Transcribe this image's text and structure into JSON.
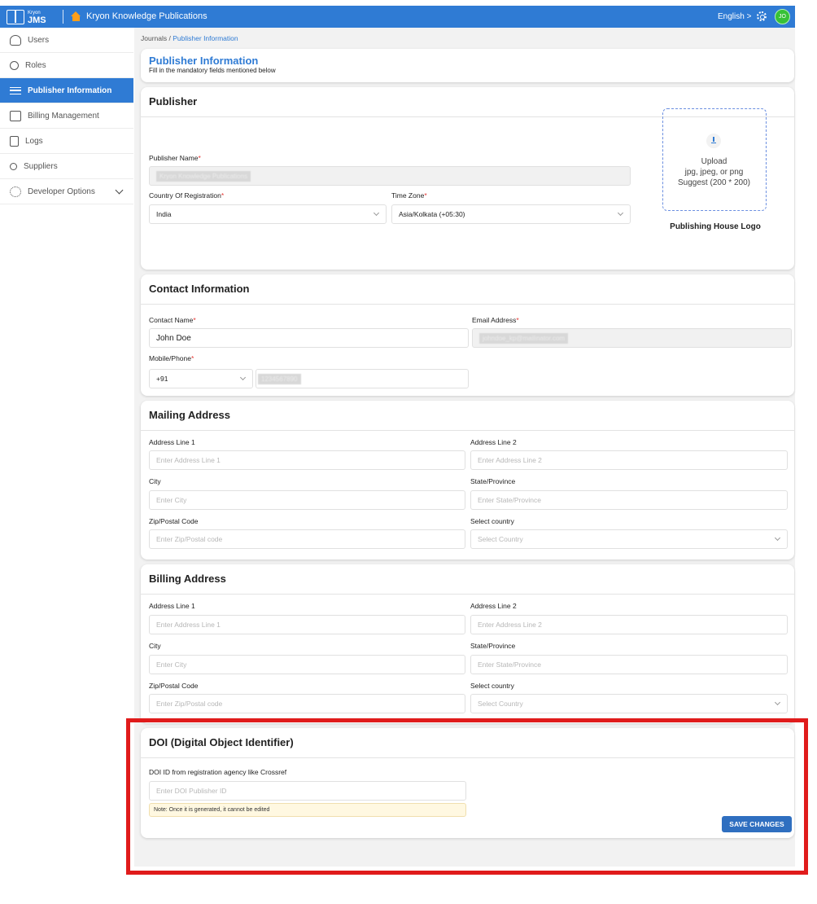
{
  "topbar": {
    "logo_small": "Kryon",
    "logo_big": "JMS",
    "app_title": "Kryon Knowledge Publications",
    "language": "English >",
    "avatar_initials": "JO",
    "brand_color": "#2f7bd4"
  },
  "sidebar": {
    "items": [
      {
        "label": "Users",
        "icon": "user-icon"
      },
      {
        "label": "Roles",
        "icon": "role-icon"
      },
      {
        "label": "Publisher Information",
        "icon": "sliders-icon",
        "active": true
      },
      {
        "label": "Billing Management",
        "icon": "billing-icon"
      },
      {
        "label": "Logs",
        "icon": "logs-icon"
      },
      {
        "label": "Suppliers",
        "icon": "suppliers-icon"
      },
      {
        "label": "Developer Options",
        "icon": "developer-gear-icon"
      }
    ]
  },
  "breadcrumb": {
    "root": "Journals",
    "sep": "/",
    "current": "Publisher Information"
  },
  "header": {
    "title": "Publisher Information",
    "subtitle": "Fill in the mandatory fields mentioned below"
  },
  "publisher": {
    "title": "Publisher",
    "name_label": "Publisher Name",
    "name_value": "Kryon Knowledge Publications",
    "country_label": "Country Of Registration",
    "country_value": "India",
    "timezone_label": "Time Zone",
    "timezone_value": "Asia/Kolkata (+05:30)",
    "upload_label": "Upload",
    "upload_formats": "jpg, jpeg, or png",
    "upload_suggest": "Suggest (200 * 200)",
    "logo_caption": "Publishing House Logo",
    "required_mark": "*"
  },
  "contact": {
    "title": "Contact Information",
    "name_label": "Contact Name",
    "name_value": "John Doe",
    "email_label": "Email Address",
    "email_value": "johndoe_kp@mailinator.com",
    "phone_label": "Mobile/Phone",
    "phone_code": "+91",
    "phone_value": "1234567890"
  },
  "mailing": {
    "title": "Mailing Address",
    "line1_label": "Address Line 1",
    "line1_ph": "Enter Address Line 1",
    "line2_label": "Address Line 2",
    "line2_ph": "Enter Address Line 2",
    "city_label": "City",
    "city_ph": "Enter City",
    "state_label": "State/Province",
    "state_ph": "Enter State/Province",
    "zip_label": "Zip/Postal Code",
    "zip_ph": "Enter Zip/Postal code",
    "country_label": "Select country",
    "country_ph": "Select Country"
  },
  "billing": {
    "title": "Billing Address",
    "line1_label": "Address Line 1",
    "line1_ph": "Enter Address Line 1",
    "line2_label": "Address Line 2",
    "line2_ph": "Enter Address Line 2",
    "city_label": "City",
    "city_ph": "Enter City",
    "state_label": "State/Province",
    "state_ph": "Enter State/Province",
    "zip_label": "Zip/Postal Code",
    "zip_ph": "Enter Zip/Postal code",
    "country_label": "Select country",
    "country_ph": "Select Country"
  },
  "doi": {
    "title": "DOI (Digital Object Identifier)",
    "id_label": "DOI ID from registration agency like Crossref",
    "id_ph": "Enter DOI Publisher ID",
    "note": "Note: Once it is generated, it cannot be edited"
  },
  "actions": {
    "save_label": "SAVE CHANGES"
  },
  "highlight_color": "#e01b1b"
}
